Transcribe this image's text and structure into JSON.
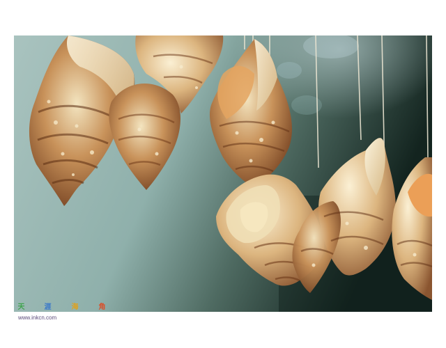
{
  "photo": {
    "subject_icon": "seashell-wind-chime",
    "palette": {
      "background_left": "#a7c0bc",
      "background_right": "#1a2b26",
      "shell_cream": "#e9d7ae",
      "shell_brown": "#8a4a24",
      "string": "#e8e2d0"
    }
  },
  "watermark": {
    "chars": [
      "天",
      "涯",
      "海",
      "角"
    ],
    "char_colors": [
      "#3fa34d",
      "#3a78c9",
      "#e0a21d",
      "#d94f2a"
    ],
    "url": "www.inkcn.com"
  }
}
